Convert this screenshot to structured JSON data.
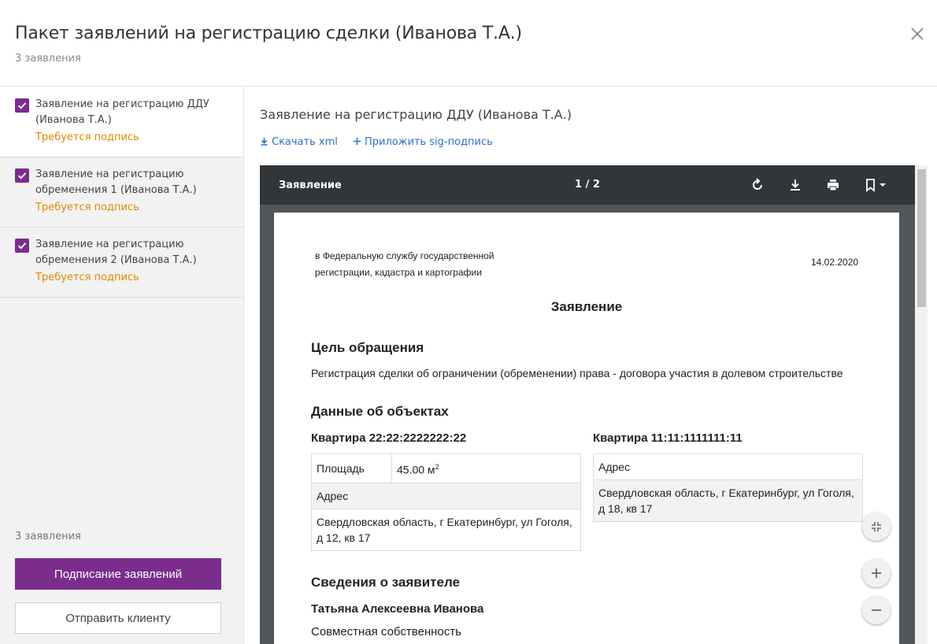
{
  "header": {
    "title": "Пакет заявлений на регистрацию сделки (Иванова Т.А.)",
    "subtitle": "3 заявления"
  },
  "sidebar": {
    "items": [
      {
        "name": "Заявление на регистрацию ДДУ (Иванова Т.А.)",
        "status": "Требуется подпись"
      },
      {
        "name": "Заявление на регистрацию обременения 1 (Иванова Т.А.)",
        "status": "Требуется подпись"
      },
      {
        "name": "Заявление на регистрацию обременения 2 (Иванова Т.А.)",
        "status": "Требуется подпись"
      }
    ],
    "count_label": "3 заявления",
    "sign_button": "Подписание заявлений",
    "send_button": "Отправить клиенту"
  },
  "main": {
    "title": "Заявление на регистрацию ДДУ (Иванова Т.А.)",
    "download_link": "Скачать xml",
    "attach_link": "Приложить sig-подпись"
  },
  "viewer": {
    "toolbar_title": "Заявление",
    "page_indicator": "1 / 2"
  },
  "document": {
    "addressee_line1": "в Федеральную службу государственной",
    "addressee_line2": "регистрации, кадастра и картографии",
    "date": "14.02.2020",
    "heading": "Заявление",
    "purpose_title": "Цель обращения",
    "purpose_text": "Регистрация сделки об ограничении (обременении) права - договора участия в долевом строительстве",
    "objects_title": "Данные об объектах",
    "object1": {
      "title": "Квартира 22:22:2222222:22",
      "area_label": "Площадь",
      "area_value": "45.00 м",
      "area_sup": "2",
      "address_label": "Адрес",
      "address_value": "Свердловская область, г Екатеринбург, ул Гоголя, д 12, кв 17"
    },
    "object2": {
      "title": "Квартира 11:11:1111111:11",
      "address_label": "Адрес",
      "address_value": "Свердловская область, г Екатеринбург, ул Гоголя, д 18, кв 17"
    },
    "applicant_title": "Сведения о заявителе",
    "applicant_name": "Татьяна Алексеевна Иванова",
    "ownership": "Совместная собственность"
  },
  "colors": {
    "accent": "#7b2d8e",
    "warning": "#e08a00",
    "link": "#2a73c4",
    "viewer_toolbar": "#323639"
  },
  "icons": [
    "close-icon",
    "checkbox-checked-icon",
    "download-icon",
    "plus-icon",
    "rotate-icon",
    "print-icon",
    "bookmark-icon",
    "fit-page-icon",
    "zoom-in-icon",
    "zoom-out-icon"
  ]
}
